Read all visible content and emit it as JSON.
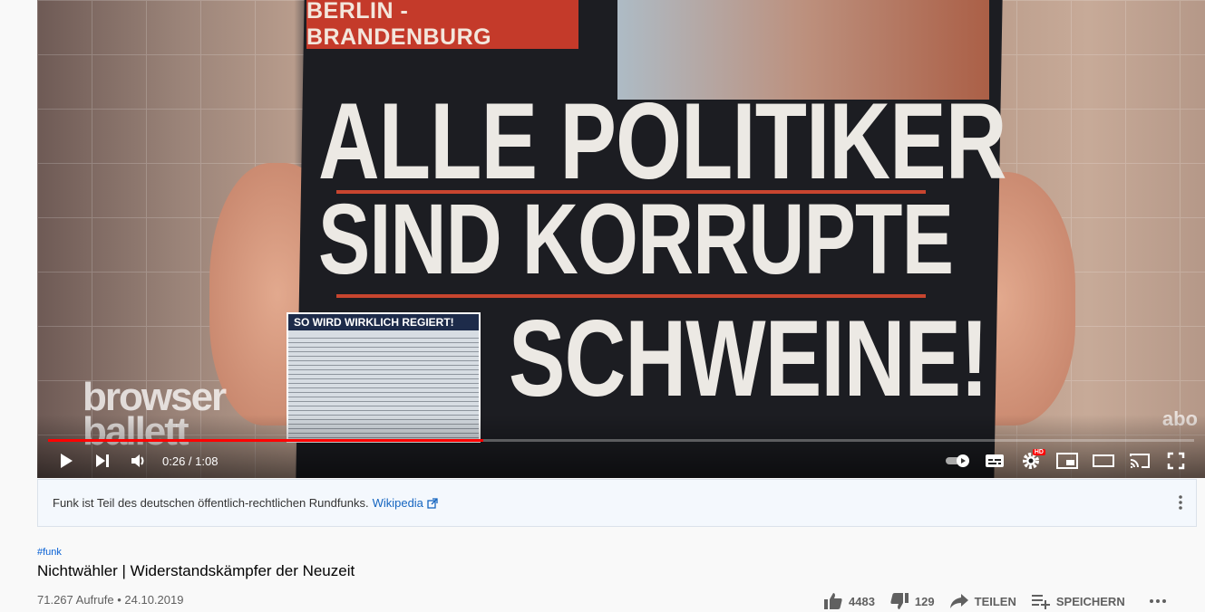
{
  "video": {
    "newspaper_region": "BERLIN - BRANDENBURG",
    "headline_line1": "ALLE POLITIKER",
    "headline_line2": "SIND KORRUPTE",
    "headline_line3": "SCHWEINE!",
    "inset_title": "SO WIRD WIRKLICH REGIERT!",
    "watermark_left_line1": "browser",
    "watermark_left_line2": "ballett",
    "watermark_right": "abo"
  },
  "player": {
    "current_time": "0:26",
    "duration": "1:08",
    "time_display": "0:26 / 1:08",
    "progress_fraction": 0.38,
    "hd_badge": "HD"
  },
  "info_panel": {
    "text": "Funk ist Teil des deutschen öffentlich-rechtlichen Rundfunks.",
    "link_label": "Wikipedia"
  },
  "video_info": {
    "hashtag": "#funk",
    "title": "Nichtwähler | Widerstandskämpfer der Neuzeit",
    "views": "71.267 Aufrufe",
    "separator": "•",
    "date": "24.10.2019"
  },
  "actions": {
    "likes": "4483",
    "dislikes": "129",
    "share_label": "TEILEN",
    "save_label": "SPEICHERN"
  },
  "colors": {
    "progress_red": "#ff0000",
    "link_blue": "#065fd4"
  }
}
